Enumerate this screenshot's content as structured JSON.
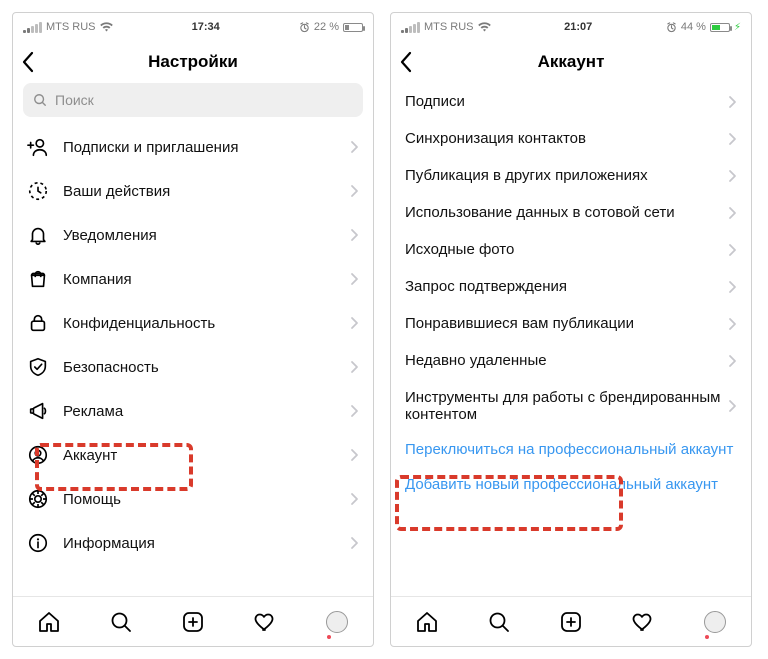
{
  "left": {
    "status": {
      "carrier": "MTS RUS",
      "wifi": "on",
      "time": "17:34",
      "alarm": "on",
      "battery_pct": "22 %",
      "charging": false
    },
    "title": "Настройки",
    "search_placeholder": "Поиск",
    "items": [
      {
        "icon": "person-add",
        "label": "Подписки и приглашения"
      },
      {
        "icon": "activity",
        "label": "Ваши действия"
      },
      {
        "icon": "bell",
        "label": "Уведомления"
      },
      {
        "icon": "bag",
        "label": "Компания"
      },
      {
        "icon": "lock",
        "label": "Конфиденциальность"
      },
      {
        "icon": "shield",
        "label": "Безопасность"
      },
      {
        "icon": "megaphone",
        "label": "Реклама"
      },
      {
        "icon": "account",
        "label": "Аккаунт"
      },
      {
        "icon": "help",
        "label": "Помощь"
      },
      {
        "icon": "info",
        "label": "Информация"
      }
    ]
  },
  "right": {
    "status": {
      "carrier": "MTS RUS",
      "wifi": "on",
      "time": "21:07",
      "alarm": "on",
      "battery_pct": "44 %",
      "charging": true
    },
    "title": "Аккаунт",
    "items": [
      {
        "label": "Подписи"
      },
      {
        "label": "Синхронизация контактов"
      },
      {
        "label": "Публикация в других приложениях"
      },
      {
        "label": "Использование данных в сотовой сети"
      },
      {
        "label": "Исходные фото"
      },
      {
        "label": "Запрос подтверждения"
      },
      {
        "label": "Понравившиеся вам публикации"
      },
      {
        "label": "Недавно удаленные"
      },
      {
        "label": "Инструменты для работы с брендированным контентом"
      }
    ],
    "links": [
      "Переключиться на профессиональный аккаунт",
      "Добавить новый профессиональный аккаунт"
    ]
  }
}
